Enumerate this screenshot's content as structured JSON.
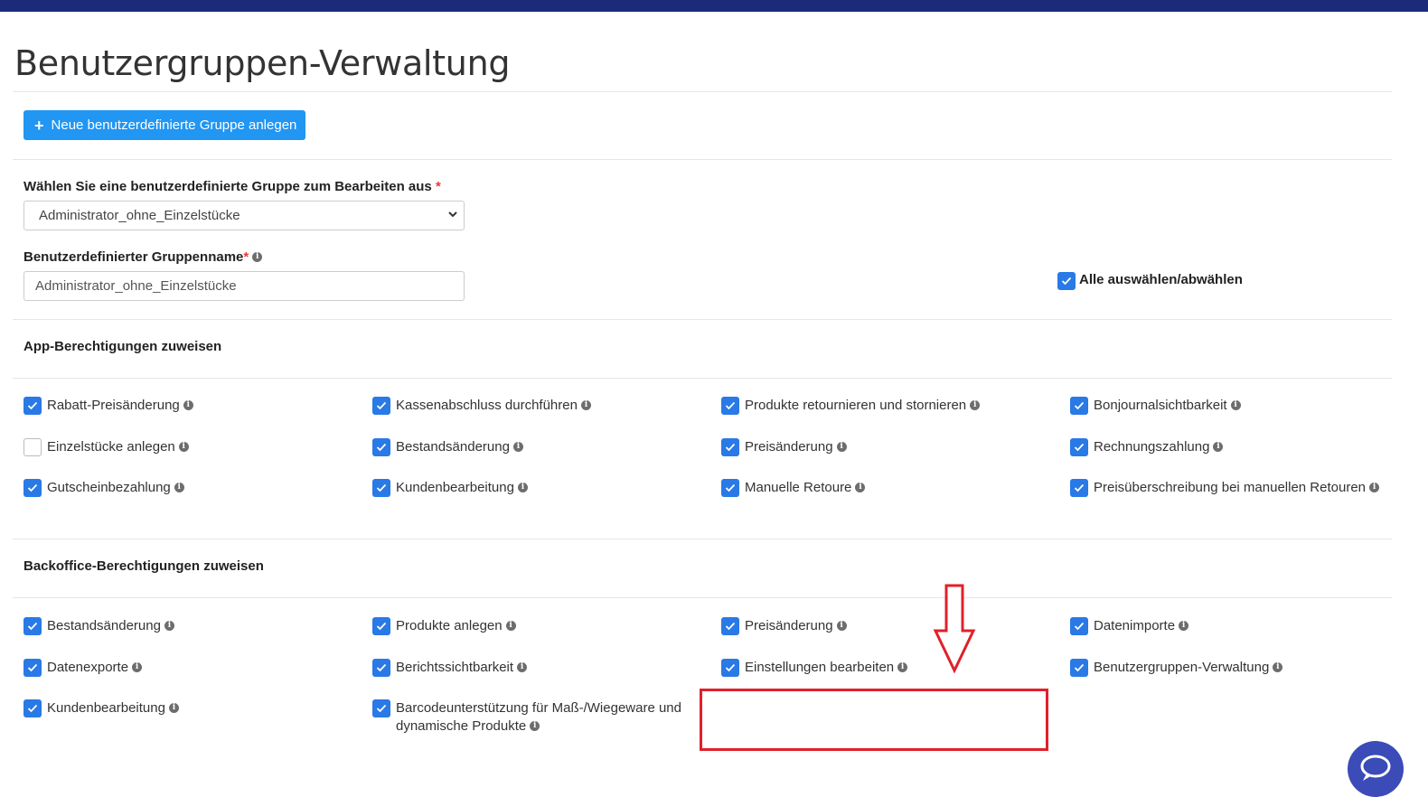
{
  "page": {
    "title": "Benutzergruppen-Verwaltung",
    "new_group_button": "Neue benutzerdefinierte Gruppe anlegen"
  },
  "form": {
    "select_label": "Wählen Sie eine benutzerdefinierte Gruppe zum Bearbeiten aus",
    "select_value": "Administrator_ohne_Einzelstücke",
    "name_label": "Benutzerdefinierter Gruppenname",
    "name_value": "Administrator_ohne_Einzelstücke",
    "required_mark": "*",
    "select_all_label": "Alle auswählen/abwählen",
    "select_all_checked": true
  },
  "app_permissions": {
    "title": "App-Berechtigungen zuweisen",
    "items": [
      {
        "label": "Rabatt-Preisänderung",
        "checked": true
      },
      {
        "label": "Kassenabschluss durchführen",
        "checked": true
      },
      {
        "label": "Produkte retournieren und stornieren",
        "checked": true
      },
      {
        "label": "Bonjournalsichtbarkeit",
        "checked": true
      },
      {
        "label": "Einzelstücke anlegen",
        "checked": false
      },
      {
        "label": "Bestandsänderung",
        "checked": true
      },
      {
        "label": "Preisänderung",
        "checked": true
      },
      {
        "label": "Rechnungszahlung",
        "checked": true
      },
      {
        "label": "Gutscheinbezahlung",
        "checked": true
      },
      {
        "label": "Kundenbearbeitung",
        "checked": true
      },
      {
        "label": "Manuelle Retoure",
        "checked": true
      },
      {
        "label": "Preisüberschreibung bei manuellen Retouren",
        "checked": true
      }
    ]
  },
  "backoffice_permissions": {
    "title": "Backoffice-Berechtigungen zuweisen",
    "items": [
      {
        "label": "Bestandsänderung",
        "checked": true
      },
      {
        "label": "Produkte anlegen",
        "checked": true
      },
      {
        "label": "Preisänderung",
        "checked": true
      },
      {
        "label": "Datenimporte",
        "checked": true
      },
      {
        "label": "Datenexporte",
        "checked": true
      },
      {
        "label": "Berichtssichtbarkeit",
        "checked": true
      },
      {
        "label": "Einstellungen bearbeiten",
        "checked": true
      },
      {
        "label": "Benutzergruppen-Verwaltung",
        "checked": true
      },
      {
        "label": "Kundenbearbeitung",
        "checked": true
      },
      {
        "label": "Barcodeunterstützung für Maß-/Wiegeware und",
        "label_line2": "dynamische Produkte",
        "checked": true
      }
    ]
  },
  "icons": {
    "info": "info-circle-icon",
    "checkmark": "check-icon",
    "chat": "chat-icon",
    "arrow": "down-arrow-icon",
    "plus": "plus-icon"
  },
  "colors": {
    "topbar": "#1c2a7a",
    "primary_button": "#2196f3",
    "checkbox": "#2979e6",
    "highlight": "#e0202a",
    "chat": "#3b4bb8"
  }
}
